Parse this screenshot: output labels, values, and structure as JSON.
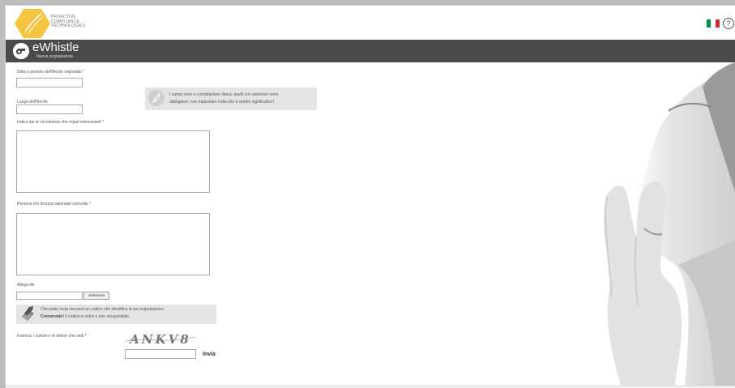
{
  "header": {
    "brand_lines": [
      "PROACTIVE",
      "COMPLIANCE",
      "TECHNOLOGIES"
    ],
    "help_label": "?",
    "flag_colors": [
      "#009246",
      "#ffffff",
      "#ce2b37"
    ]
  },
  "appbar": {
    "title": "eWhistle",
    "subtitle": "Nuova segnalazione"
  },
  "form": {
    "date_label": "Data o periodo dell'illecito segnalato *",
    "place_label": "Luogo dell'illecito",
    "info_note_line1": "I campi sono a compilazione libera, quelli con asterisco sono",
    "info_note_line2": "obbligatori: non tralasciare nulla che ti sembri significativo!",
    "circumstances_label": "Indica qui le circostanze che reputi interessanti *",
    "persons_label": "Persone e/o funzioni aziendali coinvolte *",
    "attach_label": "Allega file",
    "select_button": "Seleziona",
    "code_note_line1": "Cliccando invia riceverai un codice che identifica la tua segnalazione.",
    "code_note_bold": "Conservalo!",
    "code_note_line2": " Il codice è unico e non recuperabile.",
    "captcha_label": "Inserisci i numeri e le lettere che vedi *",
    "captcha_text": "ANKV8",
    "submit_label": "Invia"
  },
  "colors": {
    "logo": "#f5c542",
    "appbar": "#4a4a4a"
  }
}
